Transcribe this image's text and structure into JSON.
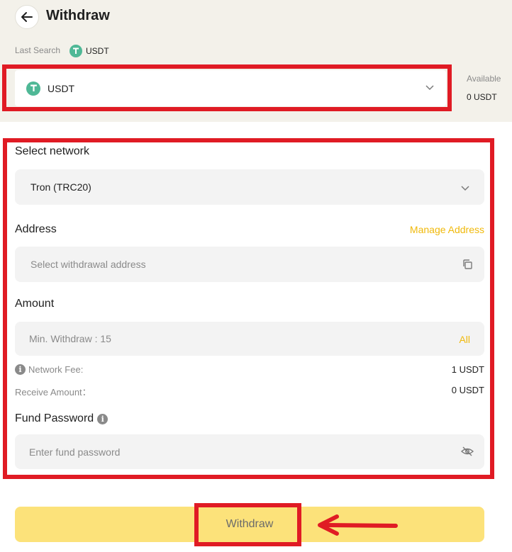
{
  "header": {
    "title": "Withdraw"
  },
  "last_search": {
    "label": "Last Search",
    "coin": "USDT"
  },
  "coin_select": {
    "value": "USDT",
    "icon": "tether-icon"
  },
  "available": {
    "label": "Available",
    "value": "0 USDT"
  },
  "network": {
    "label": "Select network",
    "value": "Tron (TRC20)"
  },
  "address": {
    "label": "Address",
    "manage_link": "Manage Address",
    "placeholder": "Select withdrawal address"
  },
  "amount": {
    "label": "Amount",
    "placeholder": "Min. Withdraw : 15",
    "all_link": "All"
  },
  "fees": {
    "network_fee_label": "Network Fee:",
    "network_fee_value": "1 USDT",
    "receive_label": "Receive Amount：",
    "receive_value": "0 USDT"
  },
  "fund_password": {
    "label": "Fund Password",
    "placeholder": "Enter fund password"
  },
  "submit": {
    "label": "Withdraw"
  },
  "colors": {
    "accent": "#f0b90b",
    "button_bg": "#fce27a",
    "annotation": "#e01b24",
    "usdt_green": "#4fb896"
  }
}
